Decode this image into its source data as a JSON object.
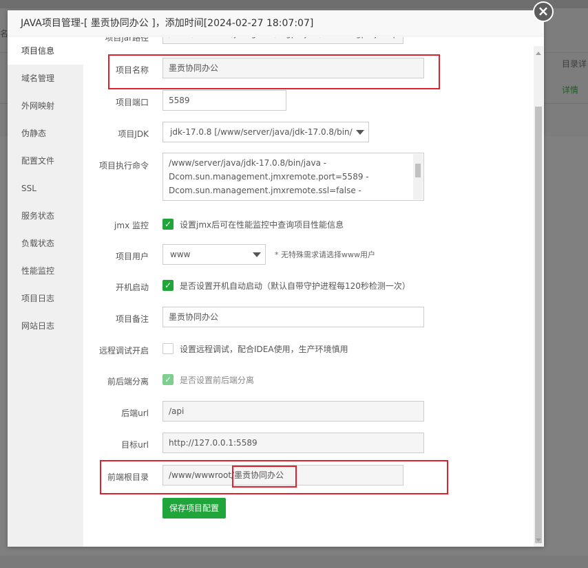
{
  "background": {
    "left_text": "名",
    "col_header": "目录详",
    "detail_link": "详情"
  },
  "modal": {
    "title": "JAVA项目管理-[ 墨贡协同办公 ]，添加时间[2024-02-27 18:07:07]",
    "close_icon": "×"
  },
  "sidebar": {
    "items": [
      {
        "label": "项目信息"
      },
      {
        "label": "域名管理"
      },
      {
        "label": "外网映射"
      },
      {
        "label": "伪静态"
      },
      {
        "label": "配置文件"
      },
      {
        "label": "SSL"
      },
      {
        "label": "服务状态"
      },
      {
        "label": "负载状态"
      },
      {
        "label": "性能监控"
      },
      {
        "label": "项目日志"
      },
      {
        "label": "网站日志"
      }
    ]
  },
  "form": {
    "path_label": "项目jar路径",
    "path_value": "/www/wwwroot/jeecgboot/mgproject/lbwm-mgproject-pro",
    "name_label": "项目名称",
    "name_value": "墨贡协同办公",
    "port_label": "项目端口",
    "port_value": "5589",
    "jdk_label": "项目JDK",
    "jdk_value": "jdk-17.0.8 [/www/server/java/jdk-17.0.8/bin/",
    "cmd_label": "项目执行命令",
    "cmd_lines": [
      "/www/server/java/jdk-17.0.8/bin/java -",
      "Dcom.sun.management.jmxremote.port=5589 -",
      "Dcom.sun.management.jmxremote.ssl=false -"
    ],
    "jmx_label": "jmx 监控",
    "jmx_text": "设置jmx后可在性能监控中查询项目性能信息",
    "user_label": "项目用户",
    "user_value": "www",
    "user_hint": "* 无特殊需求请选择www用户",
    "boot_label": "开机启动",
    "boot_text": "是否设置开机自动启动（默认自带守护进程每120秒检测一次）",
    "note_label": "项目备注",
    "note_value": "墨贡协同办公",
    "debug_label": "远程调试开启",
    "debug_text": "设置远程调试，配合IDEA使用，生产环境慎用",
    "split_label": "前后端分离",
    "split_text": "是否设置前后端分离",
    "backend_label": "后端url",
    "backend_value": "/api",
    "target_label": "目标url",
    "target_value": "http://127.0.0.1:5589",
    "front_label": "前端根目录",
    "front_prefix": "/www/wwwroot/",
    "front_suffix": "墨贡协同办公",
    "save_label": "保存项目配置"
  },
  "colors": {
    "accent": "#20a53a",
    "highlight": "#e0202a"
  }
}
